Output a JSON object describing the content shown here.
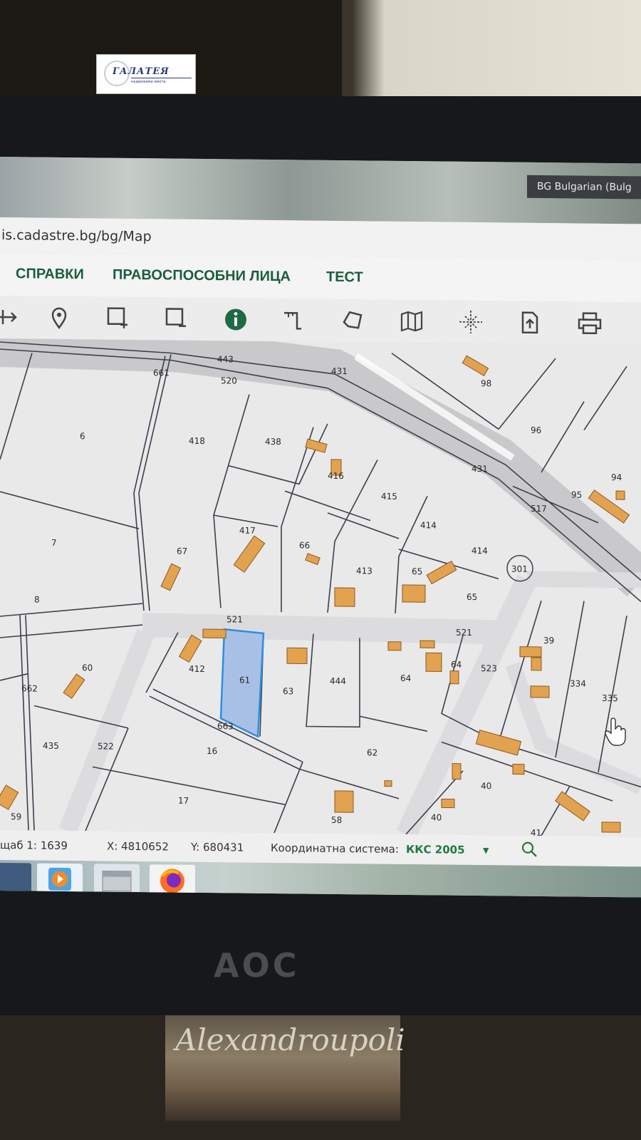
{
  "logo": {
    "name": "ГАЛАТЕЯ",
    "tagline": "недвижими имоти"
  },
  "language_indicator": "BG Bulgarian (Bulg",
  "browser": {
    "url": "is.cadastre.bg/bg/Map"
  },
  "menu": {
    "items": [
      "СПРАВКИ",
      "ПРАВОСПОСОБНИ ЛИЦА",
      "ТЕСТ"
    ]
  },
  "toolbar": {
    "tools": [
      "pan-icon",
      "location-pin-icon",
      "add-area-icon",
      "remove-area-icon",
      "info-icon",
      "measure-icon",
      "polygon-icon",
      "map-layers-icon",
      "crosshair-icon",
      "upload-icon",
      "print-icon"
    ]
  },
  "map": {
    "selected_parcel": "61",
    "parcel_labels": [
      "443",
      "661",
      "520",
      "431",
      "98",
      "6",
      "418",
      "438",
      "96",
      "431",
      "416",
      "94",
      "415",
      "95",
      "517",
      "7",
      "417",
      "67",
      "66",
      "414",
      "414",
      "413",
      "65",
      "65",
      "301",
      "8",
      "521",
      "521",
      "39",
      "60",
      "412",
      "61",
      "63",
      "444",
      "64",
      "64",
      "523",
      "334",
      "335",
      "662",
      "663",
      "435",
      "522",
      "16",
      "62",
      "40",
      "17",
      "59",
      "58",
      "40",
      "41"
    ],
    "colors": {
      "building": "#e3a24f",
      "selected_fill": "#a9c0e6",
      "selected_stroke": "#2e8fe0",
      "line": "#3a3f4a"
    }
  },
  "status": {
    "scale": "щаб 1: 1639",
    "x": "X: 4810652",
    "y": "Y: 680431",
    "crs_label": "Координатна система:",
    "crs_value": "ККС 2005"
  },
  "monitor_brand": "AOC",
  "photo_caption": "Alexandroupoli"
}
